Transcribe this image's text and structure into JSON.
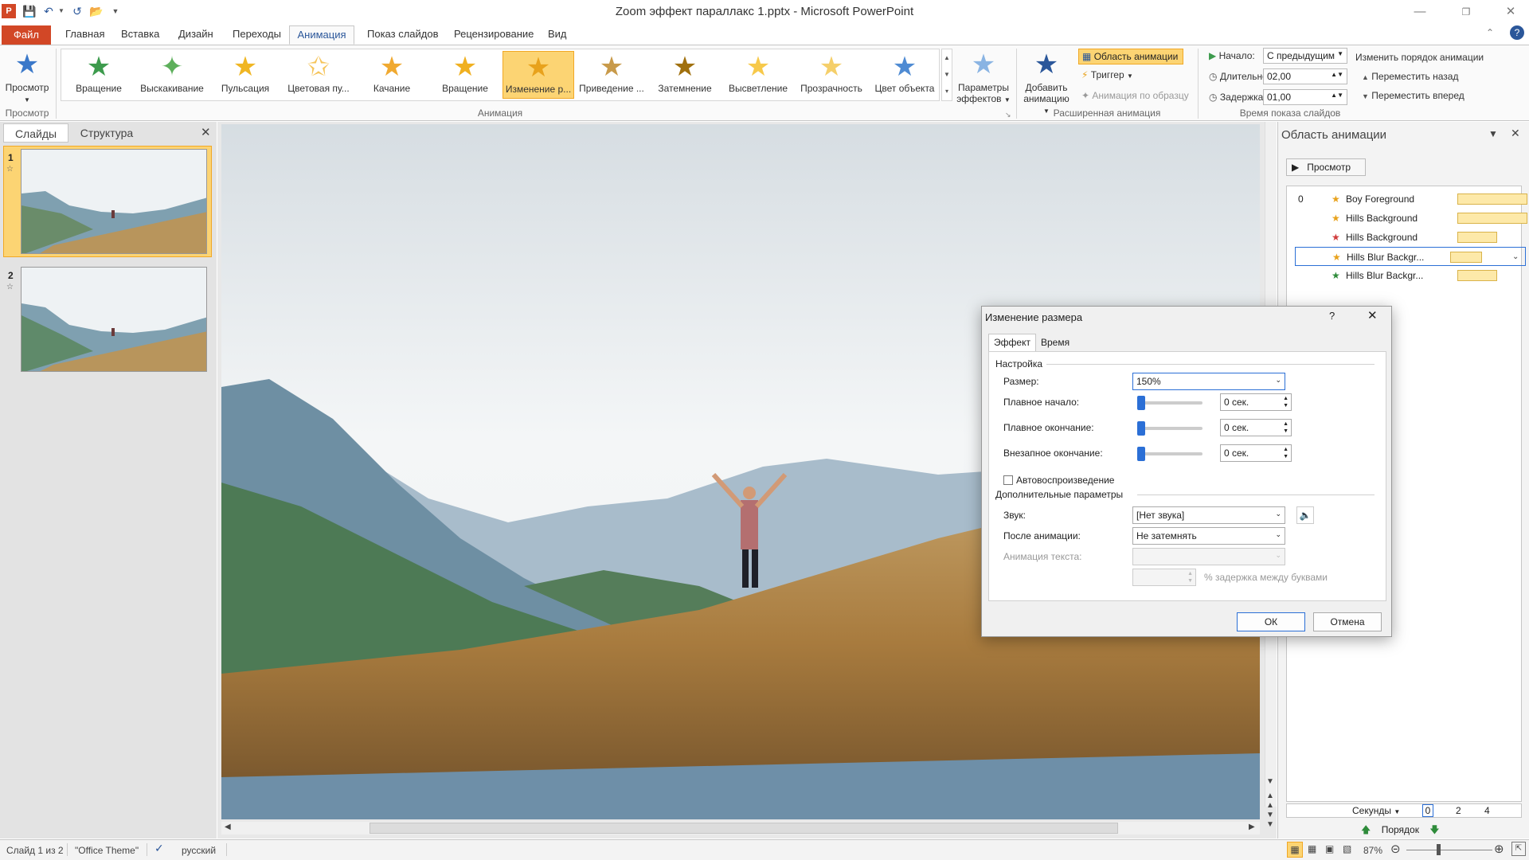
{
  "window": {
    "title": "Zoom эффект параллакс 1.pptx - Microsoft PowerPoint",
    "minimize_icon": "minimize-icon",
    "restore_icon": "restore-icon",
    "close_icon": "close-icon"
  },
  "tabs": [
    "Файл",
    "Главная",
    "Вставка",
    "Дизайн",
    "Переходы",
    "Анимация",
    "Показ слайдов",
    "Рецензирование",
    "Вид"
  ],
  "ribbon": {
    "preview_label": "Просмотр",
    "preview_group": "Просмотр",
    "gallery_items": [
      "Вращение",
      "Выскакивание",
      "Пульсация",
      "Цветовая пу...",
      "Качание",
      "Вращение",
      "Изменение р...",
      "Приведение ...",
      "Затемнение",
      "Высветление",
      "Прозрачность",
      "Цвет объекта"
    ],
    "gallery_selected": 6,
    "animation_group": "Анимация",
    "effect_params_line1": "Параметры",
    "effect_params_line2": "эффектов",
    "add_anim_line1": "Добавить",
    "add_anim_line2": "анимацию",
    "anim_pane_btn": "Область анимации",
    "trigger_btn": "Триггер",
    "anim_painter_btn": "Анимация по образцу",
    "advanced_group": "Расширенная анимация",
    "start_label": "Начало:",
    "start_value": "С предыдущим",
    "duration_label": "Длительность:",
    "duration_value": "02,00",
    "delay_label": "Задержка:",
    "delay_value": "01,00",
    "reorder_label": "Изменить порядок анимации",
    "move_back": "Переместить назад",
    "move_forward": "Переместить вперед",
    "timing_group": "Время показа слайдов"
  },
  "left_panel": {
    "tab_slides": "Слайды",
    "tab_outline": "Структура",
    "slides": [
      {
        "num": "1"
      },
      {
        "num": "2"
      }
    ]
  },
  "anim_pane": {
    "title": "Область анимации",
    "play_btn": "Просмотр",
    "step_number": "0",
    "items": [
      {
        "name": "Boy Foreground",
        "icon": "zoom-star-icon"
      },
      {
        "name": "Hills Background",
        "icon": "zoom-star-icon"
      },
      {
        "name": "Hills Background",
        "icon": "red-star-icon"
      },
      {
        "name": "Hills Blur Backgr...",
        "icon": "zoom-star-icon"
      },
      {
        "name": "Hills Blur Backgr...",
        "icon": "green-star-icon"
      }
    ],
    "seconds_label": "Секунды",
    "timeline_ticks": [
      "0",
      "2",
      "4"
    ],
    "order_label": "Порядок"
  },
  "dialog": {
    "title": "Изменение размера",
    "help": "?",
    "tab_effect": "Эффект",
    "tab_timing": "Время",
    "section_settings": "Настройка",
    "size_label": "Размер:",
    "size_value": "150%",
    "smooth_start_label": "Плавное начало:",
    "smooth_start_value": "0 сек.",
    "smooth_end_label": "Плавное окончание:",
    "smooth_end_value": "0 сек.",
    "bounce_end_label": "Внезапное окончание:",
    "bounce_end_value": "0 сек.",
    "autoreverse_label": "Автовоспроизведение",
    "section_enhancements": "Дополнительные параметры",
    "sound_label": "Звук:",
    "sound_value": "[Нет звука]",
    "after_anim_label": "После анимации:",
    "after_anim_value": "Не затемнять",
    "anim_text_label": "Анимация текста:",
    "anim_text_value": "",
    "delay_letters_label": "% задержка между буквами",
    "ok": "ОК",
    "cancel": "Отмена"
  },
  "status": {
    "slide_info": "Слайд 1 из 2",
    "theme": "\"Office Theme\"",
    "language": "русский",
    "zoom": "87%"
  },
  "colors": {
    "file_tab": "#d24726",
    "accent": "#2b579a",
    "selected_gallery": "#fcd473",
    "anim_bar": "#fde9a9"
  }
}
